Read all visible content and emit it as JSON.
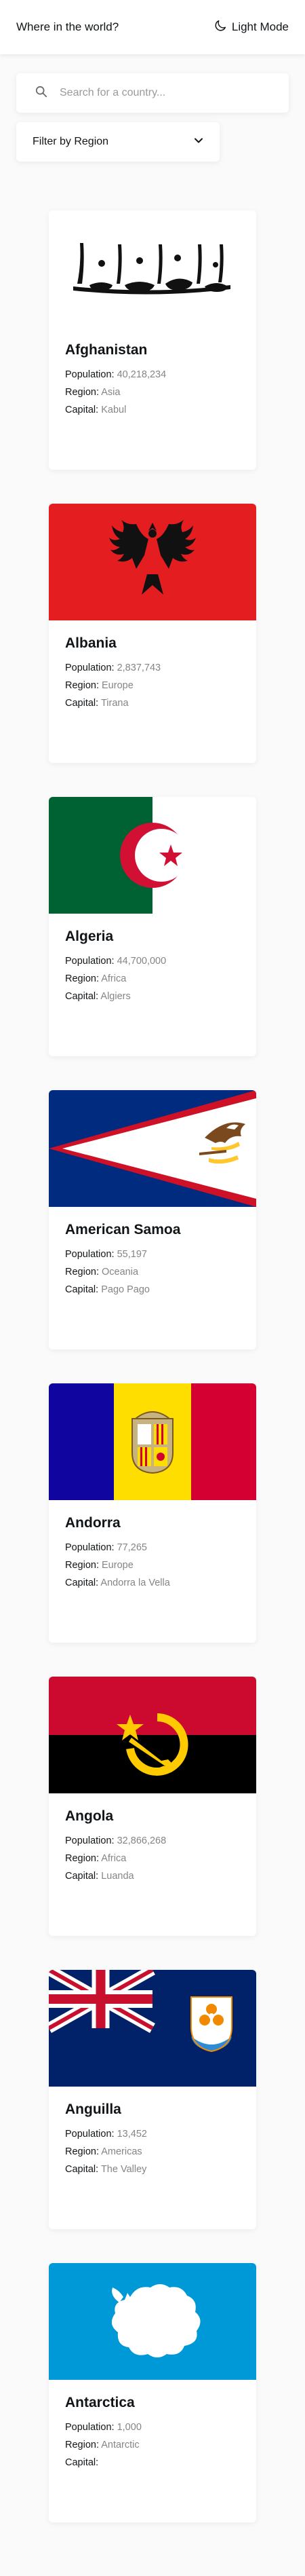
{
  "header": {
    "title": "Where in the world?",
    "mode_label": "Light Mode"
  },
  "search": {
    "placeholder": "Search for a country..."
  },
  "filter": {
    "label": "Filter by Region"
  },
  "labels": {
    "population": "Population:",
    "region": "Region:",
    "capital": "Capital:"
  },
  "countries": [
    {
      "name": "Afghanistan",
      "population": "40,218,234",
      "region": "Asia",
      "capital": "Kabul",
      "flag_icon": "afghanistan-flag-icon"
    },
    {
      "name": "Albania",
      "population": "2,837,743",
      "region": "Europe",
      "capital": "Tirana",
      "flag_icon": "albania-flag-icon"
    },
    {
      "name": "Algeria",
      "population": "44,700,000",
      "region": "Africa",
      "capital": "Algiers",
      "flag_icon": "algeria-flag-icon"
    },
    {
      "name": "American Samoa",
      "population": "55,197",
      "region": "Oceania",
      "capital": "Pago Pago",
      "flag_icon": "american-samoa-flag-icon"
    },
    {
      "name": "Andorra",
      "population": "77,265",
      "region": "Europe",
      "capital": "Andorra la Vella",
      "flag_icon": "andorra-flag-icon"
    },
    {
      "name": "Angola",
      "population": "32,866,268",
      "region": "Africa",
      "capital": "Luanda",
      "flag_icon": "angola-flag-icon"
    },
    {
      "name": "Anguilla",
      "population": "13,452",
      "region": "Americas",
      "capital": "The Valley",
      "flag_icon": "anguilla-flag-icon"
    },
    {
      "name": "Antarctica",
      "population": "1,000",
      "region": "Antarctic",
      "capital": "",
      "flag_icon": "antarctica-flag-icon"
    }
  ]
}
